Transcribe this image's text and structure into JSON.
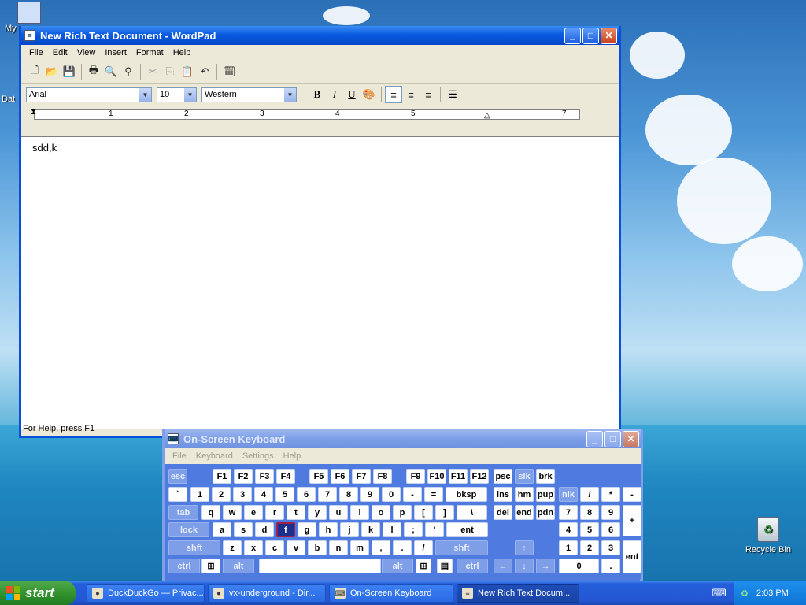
{
  "desktop": {
    "icons": [
      {
        "label": "My"
      },
      {
        "label": "Dat"
      },
      {
        "label": "Recycle Bin"
      }
    ]
  },
  "wordpad": {
    "title": "New Rich Text Document - WordPad",
    "menu": [
      "File",
      "Edit",
      "View",
      "Insert",
      "Format",
      "Help"
    ],
    "font_name": "Arial",
    "font_size": "10",
    "script": "Western",
    "ruler_numbers": [
      "1",
      "2",
      "3",
      "4",
      "5",
      "7"
    ],
    "content": "sdd,k",
    "status": "For Help, press F1"
  },
  "osk": {
    "title": "On-Screen Keyboard",
    "menu": [
      "File",
      "Keyboard",
      "Settings",
      "Help"
    ],
    "rows": {
      "r1": [
        "esc",
        "F1",
        "F2",
        "F3",
        "F4",
        "F5",
        "F6",
        "F7",
        "F8",
        "F9",
        "F10",
        "F11",
        "F12",
        "psc",
        "slk",
        "brk"
      ],
      "r2": [
        "`",
        "1",
        "2",
        "3",
        "4",
        "5",
        "6",
        "7",
        "8",
        "9",
        "0",
        "-",
        "=",
        "bksp",
        "ins",
        "hm",
        "pup",
        "nlk",
        "/",
        "*",
        "-"
      ],
      "r3": [
        "tab",
        "q",
        "w",
        "e",
        "r",
        "t",
        "y",
        "u",
        "i",
        "o",
        "p",
        "[",
        "]",
        "\\",
        "del",
        "end",
        "pdn",
        "7",
        "8",
        "9",
        "+"
      ],
      "r4": [
        "lock",
        "a",
        "s",
        "d",
        "f",
        "g",
        "h",
        "j",
        "k",
        "l",
        ";",
        "'",
        "ent",
        "4",
        "5",
        "6"
      ],
      "r5": [
        "shft",
        "z",
        "x",
        "c",
        "v",
        "b",
        "n",
        "m",
        ",",
        ".",
        "/",
        "shft",
        "↑",
        "1",
        "2",
        "3",
        "ent"
      ],
      "r6": [
        "ctrl",
        "alt",
        "alt",
        "ctrl",
        "←",
        "↓",
        "→",
        "0",
        "."
      ]
    },
    "selected_key": "f"
  },
  "taskbar": {
    "start_label": "start",
    "tasks": [
      {
        "label": "DuckDuckGo — Privac..."
      },
      {
        "label": "vx-underground - Dir..."
      },
      {
        "label": "On-Screen Keyboard"
      },
      {
        "label": "New Rich Text Docum..."
      }
    ],
    "clock": "2:03 PM"
  }
}
